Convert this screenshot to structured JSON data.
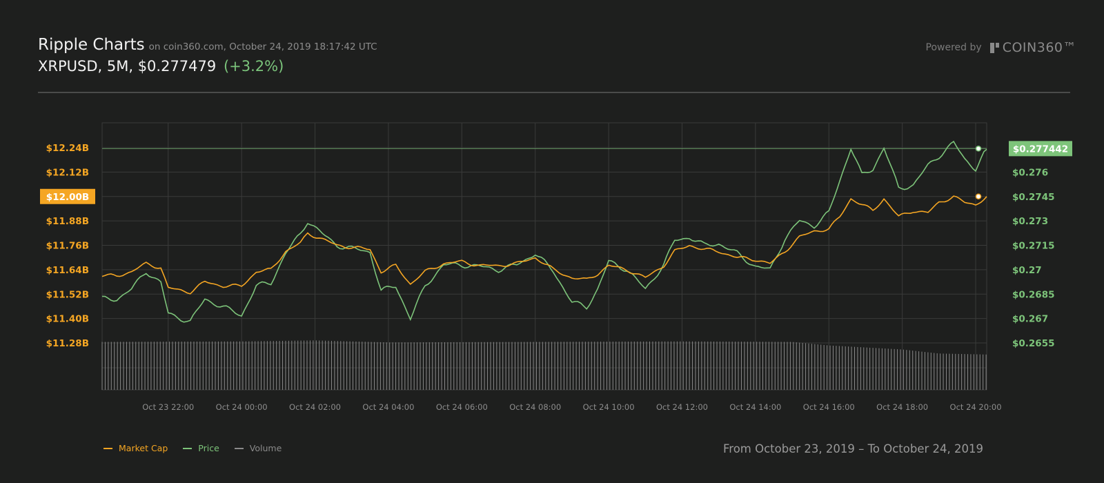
{
  "header": {
    "title": "Ripple Charts",
    "subtitle": "on coin360.com, October 24, 2019 18:17:42 UTC",
    "price_line": "XRPUSD, 5M, $0.277479",
    "change": "(+3.2%)"
  },
  "branding": {
    "powered_by": "Powered by",
    "brand": "COIN360™"
  },
  "range_text": "From October 23, 2019 – To October 24, 2019",
  "colors": {
    "market_cap": "#f5a623",
    "price": "#7dc47a",
    "volume": "#8a8a8a",
    "grid": "#3a3b3a",
    "background": "#1e1f1e"
  },
  "chart_data": {
    "type": "line",
    "x_tick_labels": [
      "Oct 23 22:00",
      "Oct 24 00:00",
      "Oct 24 02:00",
      "Oct 24 04:00",
      "Oct 24 06:00",
      "Oct 24 08:00",
      "Oct 24 10:00",
      "Oct 24 12:00",
      "Oct 24 14:00",
      "Oct 24 16:00",
      "Oct 24 18:00",
      "Oct 24 20:00"
    ],
    "x_tick_hours": [
      22,
      24,
      26,
      28,
      30,
      32,
      34,
      36,
      38,
      40,
      42,
      44
    ],
    "x_range_hours": [
      20.2,
      44.3
    ],
    "left_axis": {
      "ticks": [
        12.24,
        12.12,
        11.88,
        11.76,
        11.64,
        11.52,
        11.4,
        11.28
      ],
      "tick_labels": [
        "$12.24B",
        "$12.12B",
        "$11.88B",
        "$11.76B",
        "$11.64B",
        "$11.52B",
        "$11.40B",
        "$11.28B"
      ],
      "range": [
        11.28,
        12.24
      ],
      "current_label": "$12.00B",
      "current_value": 12.0
    },
    "right_axis": {
      "ticks": [
        0.276,
        0.2745,
        0.273,
        0.2715,
        0.27,
        0.2685,
        0.267,
        0.2655
      ],
      "tick_labels": [
        "$0.276",
        "$0.2745",
        "$0.273",
        "$0.2715",
        "$0.27",
        "$0.2685",
        "$0.267",
        "$0.2655"
      ],
      "range": [
        0.2655,
        0.2775
      ],
      "current_label": "$0.277442",
      "current_value": 0.277442
    },
    "series": [
      {
        "name": "Market Cap",
        "axis": "left",
        "points": [
          [
            20.2,
            11.61
          ],
          [
            20.6,
            11.61
          ],
          [
            21.0,
            11.63
          ],
          [
            21.4,
            11.67
          ],
          [
            21.8,
            11.65
          ],
          [
            22.0,
            11.55
          ],
          [
            22.6,
            11.53
          ],
          [
            23.0,
            11.58
          ],
          [
            23.5,
            11.56
          ],
          [
            24.0,
            11.56
          ],
          [
            24.4,
            11.63
          ],
          [
            24.8,
            11.64
          ],
          [
            25.2,
            11.73
          ],
          [
            25.6,
            11.77
          ],
          [
            25.8,
            11.82
          ],
          [
            26.2,
            11.79
          ],
          [
            26.6,
            11.76
          ],
          [
            27.0,
            11.75
          ],
          [
            27.5,
            11.74
          ],
          [
            27.8,
            11.63
          ],
          [
            28.2,
            11.66
          ],
          [
            28.6,
            11.57
          ],
          [
            29.0,
            11.63
          ],
          [
            29.5,
            11.67
          ],
          [
            30.0,
            11.68
          ],
          [
            30.5,
            11.66
          ],
          [
            31.0,
            11.66
          ],
          [
            31.5,
            11.67
          ],
          [
            32.0,
            11.7
          ],
          [
            32.5,
            11.64
          ],
          [
            33.0,
            11.6
          ],
          [
            33.4,
            11.59
          ],
          [
            33.7,
            11.62
          ],
          [
            34.0,
            11.66
          ],
          [
            34.5,
            11.64
          ],
          [
            35.0,
            11.6
          ],
          [
            35.5,
            11.66
          ],
          [
            35.8,
            11.73
          ],
          [
            36.2,
            11.76
          ],
          [
            36.6,
            11.74
          ],
          [
            37.0,
            11.73
          ],
          [
            37.5,
            11.7
          ],
          [
            38.0,
            11.69
          ],
          [
            38.4,
            11.67
          ],
          [
            38.8,
            11.73
          ],
          [
            39.2,
            11.8
          ],
          [
            39.6,
            11.83
          ],
          [
            40.0,
            11.84
          ],
          [
            40.3,
            11.9
          ],
          [
            40.6,
            11.99
          ],
          [
            40.9,
            11.96
          ],
          [
            41.2,
            11.93
          ],
          [
            41.5,
            11.99
          ],
          [
            41.9,
            11.9
          ],
          [
            42.3,
            11.93
          ],
          [
            42.7,
            11.92
          ],
          [
            43.0,
            11.97
          ],
          [
            43.4,
            12.0
          ],
          [
            43.7,
            11.97
          ],
          [
            44.0,
            11.96
          ],
          [
            44.3,
            12.0
          ]
        ]
      },
      {
        "name": "Price",
        "axis": "right",
        "points": [
          [
            20.2,
            0.2682
          ],
          [
            20.6,
            0.2682
          ],
          [
            21.0,
            0.2688
          ],
          [
            21.4,
            0.2699
          ],
          [
            21.8,
            0.2692
          ],
          [
            22.0,
            0.2673
          ],
          [
            22.6,
            0.2668
          ],
          [
            23.0,
            0.2682
          ],
          [
            23.5,
            0.2677
          ],
          [
            24.0,
            0.2672
          ],
          [
            24.4,
            0.269
          ],
          [
            24.8,
            0.2692
          ],
          [
            25.2,
            0.271
          ],
          [
            25.6,
            0.2722
          ],
          [
            25.8,
            0.273
          ],
          [
            26.2,
            0.2722
          ],
          [
            26.6,
            0.2715
          ],
          [
            27.0,
            0.2713
          ],
          [
            27.5,
            0.2711
          ],
          [
            27.8,
            0.2687
          ],
          [
            28.2,
            0.269
          ],
          [
            28.6,
            0.267
          ],
          [
            29.0,
            0.269
          ],
          [
            29.5,
            0.2703
          ],
          [
            30.0,
            0.2703
          ],
          [
            30.5,
            0.2702
          ],
          [
            31.0,
            0.27
          ],
          [
            31.5,
            0.2703
          ],
          [
            32.0,
            0.271
          ],
          [
            32.5,
            0.2699
          ],
          [
            33.0,
            0.268
          ],
          [
            33.4,
            0.2677
          ],
          [
            33.7,
            0.2688
          ],
          [
            34.0,
            0.2705
          ],
          [
            34.5,
            0.27
          ],
          [
            35.0,
            0.2688
          ],
          [
            35.5,
            0.2703
          ],
          [
            35.8,
            0.2718
          ],
          [
            36.2,
            0.272
          ],
          [
            36.6,
            0.2715
          ],
          [
            37.0,
            0.2716
          ],
          [
            37.5,
            0.271
          ],
          [
            38.0,
            0.2702
          ],
          [
            38.4,
            0.27
          ],
          [
            38.8,
            0.2719
          ],
          [
            39.2,
            0.273
          ],
          [
            39.6,
            0.2727
          ],
          [
            40.0,
            0.2735
          ],
          [
            40.3,
            0.2755
          ],
          [
            40.6,
            0.2775
          ],
          [
            40.9,
            0.2758
          ],
          [
            41.2,
            0.2762
          ],
          [
            41.5,
            0.2775
          ],
          [
            41.9,
            0.275
          ],
          [
            42.3,
            0.2752
          ],
          [
            42.7,
            0.2764
          ],
          [
            43.0,
            0.277
          ],
          [
            43.4,
            0.2778
          ],
          [
            43.7,
            0.2768
          ],
          [
            44.0,
            0.2762
          ],
          [
            44.3,
            0.2774
          ]
        ]
      },
      {
        "name": "Volume",
        "axis": "volume",
        "points": [
          [
            20.2,
            0.95
          ],
          [
            24.0,
            0.96
          ],
          [
            26.0,
            0.98
          ],
          [
            28.0,
            0.94
          ],
          [
            32.0,
            0.95
          ],
          [
            36.0,
            0.96
          ],
          [
            39.0,
            0.95
          ],
          [
            40.0,
            0.88
          ],
          [
            42.0,
            0.8
          ],
          [
            43.0,
            0.72
          ],
          [
            44.3,
            0.7
          ]
        ]
      }
    ],
    "legend": [
      "Market Cap",
      "Price",
      "Volume"
    ],
    "legend_placement": "bottom-left",
    "grid": true
  }
}
